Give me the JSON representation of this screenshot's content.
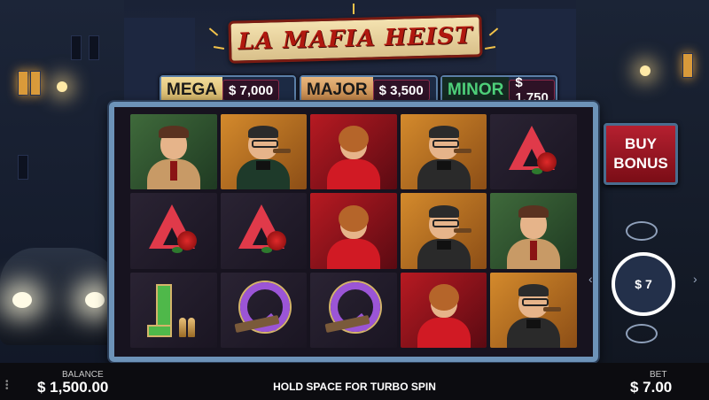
{
  "game": {
    "title": "LA MAFIA HEIST"
  },
  "jackpots": [
    {
      "name": "MEGA",
      "value": "$ 7,000",
      "color": "#f2dc9a"
    },
    {
      "name": "MAJOR",
      "value": "$ 3,500",
      "color": "#e9b77e"
    },
    {
      "name": "MINOR",
      "value": "$ 1,750",
      "color": "#4ed07a"
    }
  ],
  "reels": [
    [
      "detective",
      "boss",
      "showgirl",
      "boss",
      "a-rose"
    ],
    [
      "a-rose",
      "a-rose",
      "showgirl",
      "boss",
      "detective"
    ],
    [
      "j-bullets",
      "q-revolver",
      "q-revolver",
      "showgirl",
      "boss"
    ]
  ],
  "buy_bonus": {
    "line1": "BUY",
    "line2": "BONUS"
  },
  "spin": {
    "bet_label": "$ 7"
  },
  "footer": {
    "balance_label": "BALANCE",
    "balance_value": "$ 1,500.00",
    "hint": "HOLD SPACE FOR TURBO SPIN",
    "bet_label": "BET",
    "bet_value": "$ 7.00"
  },
  "icons": {
    "turbo": "turbo-icon",
    "autoplay": "autoplay-icon",
    "bet_down": "chevron-left-icon",
    "bet_up": "chevron-right-icon",
    "spin": "spin-arrows-icon",
    "menu": "menu-dots-icon"
  }
}
